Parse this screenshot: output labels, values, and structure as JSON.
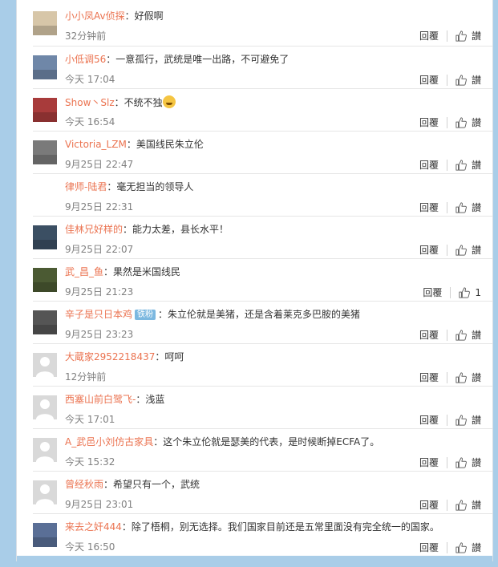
{
  "comments": [
    {
      "user": "小小凤Av侦探",
      "text": "好假啊",
      "time": "32分钟前",
      "reply": "回覆",
      "like": "讃",
      "badge": null,
      "emoji": false,
      "avatar_color": "#d7c6a8"
    },
    {
      "user": "小低调56",
      "text": "一意孤行，武统是唯一出路，不可避免了",
      "time": "今天 17:04",
      "reply": "回覆",
      "like": "讃",
      "badge": null,
      "emoji": false,
      "avatar_color": "#6f87a8"
    },
    {
      "user": "Show丶Slz",
      "text": "不统不独",
      "time": "今天 16:54",
      "reply": "回覆",
      "like": "讃",
      "badge": null,
      "emoji": true,
      "avatar_color": "#a83b3b"
    },
    {
      "user": "Victoria_LZM",
      "text": "美国线民朱立伦",
      "time": "9月25日 22:47",
      "reply": "回覆",
      "like": "讃",
      "badge": null,
      "emoji": false,
      "avatar_color": "#7a7a7a"
    },
    {
      "user": "律师-陆君",
      "text": "毫无担当的领导人",
      "time": "9月25日 22:31",
      "reply": "回覆",
      "like": "讃",
      "badge": null,
      "emoji": false,
      "avatar_color": "#ffffff"
    },
    {
      "user": "佳林兄好样的",
      "text": "能力太差，县长水平！",
      "time": "9月25日 22:07",
      "reply": "回覆",
      "like": "讃",
      "badge": null,
      "emoji": false,
      "avatar_color": "#3b4f63"
    },
    {
      "user": "武_昌_鱼",
      "text": "果然是米国线民",
      "time": "9月25日 21:23",
      "reply": "回覆",
      "like": "1",
      "badge": null,
      "emoji": false,
      "avatar_color": "#4b5a33"
    },
    {
      "user": "辛子是只日本鸡",
      "text": "朱立伦就是美猪，还是含着莱克多巴胺的美猪",
      "time": "9月25日 23:23",
      "reply": "回覆",
      "like": "讃",
      "badge": "铁粉",
      "emoji": false,
      "avatar_color": "#555555"
    },
    {
      "user": "大蔵家2952218437",
      "text": "呵呵",
      "time": "12分钟前",
      "reply": "回覆",
      "like": "讃",
      "badge": null,
      "emoji": false,
      "avatar_color": "#d9d9d9"
    },
    {
      "user": "西塞山前白鹭飞-",
      "text": "浅蓝",
      "time": "今天 17:01",
      "reply": "回覆",
      "like": "讃",
      "badge": null,
      "emoji": false,
      "avatar_color": "#d9d9d9"
    },
    {
      "user": "A_武邑小刘仿古家具",
      "text": "这个朱立伦就是瑟美的代表，是时候断掉ECFA了。",
      "time": "今天 15:32",
      "reply": "回覆",
      "like": "讃",
      "badge": null,
      "emoji": false,
      "avatar_color": "#d9d9d9"
    },
    {
      "user": "曾经秋雨",
      "text": "希望只有一个，武统",
      "time": "9月25日 23:01",
      "reply": "回覆",
      "like": "讃",
      "badge": null,
      "emoji": false,
      "avatar_color": "#d9d9d9"
    },
    {
      "user": "来去之奸444",
      "text": "除了梧桐，别无选择。我们国家目前还是五常里面没有完全统一的国家。",
      "time": "今天 16:50",
      "reply": "回覆",
      "like": "讃",
      "badge": null,
      "emoji": false,
      "avatar_color": "#5a6f96"
    }
  ],
  "colors": {
    "username": "#eb7350",
    "background": "#a9cde8",
    "time": "#808080",
    "badge": "#7cb8e0"
  },
  "icons": {
    "like": "thumbs-up-icon",
    "avatar": "user-avatar-icon",
    "emoji": "laughing-emoji-icon"
  }
}
